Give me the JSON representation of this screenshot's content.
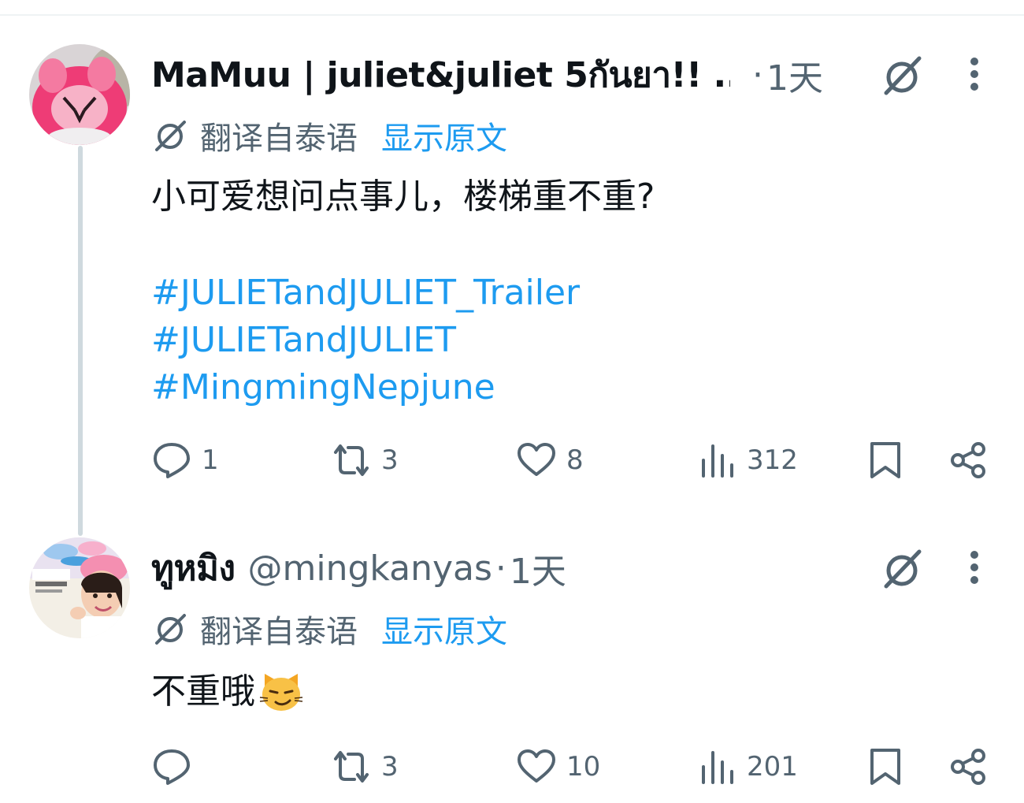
{
  "posts": [
    {
      "display_name": "MaMuu | juliet&juliet 5กันยา!! ...",
      "handle": "",
      "separator": "·",
      "time": "1天",
      "translate_label": "翻译自泰语",
      "show_original": "显示原文",
      "text": "小可爱想问点事儿，楼梯重不重?",
      "hashtags": [
        "#JULIETandJULIET_Trailer",
        "#JULIETandJULIET",
        "#MingmingNepjune"
      ],
      "actions": {
        "replies": "1",
        "reposts": "3",
        "likes": "8",
        "views": "312"
      }
    },
    {
      "display_name": "ทูหมิง",
      "handle": "@mingkanyas",
      "separator": "·",
      "time": "1天",
      "translate_label": "翻译自泰语",
      "show_original": "显示原文",
      "text": "不重哦",
      "emoji": "smirking-cat-face",
      "actions": {
        "replies": "",
        "reposts": "3",
        "likes": "10",
        "views": "201"
      }
    }
  ],
  "colors": {
    "accent": "#1d9bf0",
    "secondary_text": "#536471",
    "thread_line": "#cfd9de",
    "text": "#0f1419"
  },
  "icons": [
    "grok-icon",
    "more-icon",
    "translate-icon",
    "reply-icon",
    "repost-icon",
    "like-icon",
    "views-icon",
    "bookmark-icon",
    "share-icon"
  ]
}
